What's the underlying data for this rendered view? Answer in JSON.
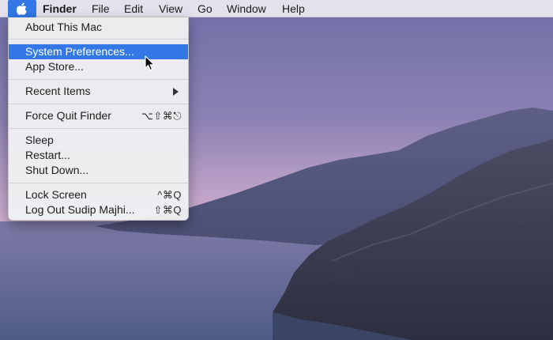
{
  "menubar": {
    "apple_icon": "apple-logo-icon",
    "items": [
      "Finder",
      "File",
      "Edit",
      "View",
      "Go",
      "Window",
      "Help"
    ]
  },
  "apple_menu": {
    "items": [
      {
        "label": "About This Mac",
        "shortcut": ""
      },
      {
        "label": "System Preferences...",
        "shortcut": "",
        "highlighted": true
      },
      {
        "label": "App Store...",
        "shortcut": ""
      },
      {
        "label": "Recent Items",
        "shortcut": "",
        "submenu": true
      },
      {
        "label": "Force Quit Finder",
        "shortcut": "⌥⇧⌘⎋"
      },
      {
        "label": "Sleep",
        "shortcut": ""
      },
      {
        "label": "Restart...",
        "shortcut": ""
      },
      {
        "label": "Shut Down...",
        "shortcut": ""
      },
      {
        "label": "Lock Screen",
        "shortcut": "^⌘Q"
      },
      {
        "label": "Log Out Sudip Majhi...",
        "shortcut": "⇧⌘Q"
      }
    ]
  },
  "colors": {
    "highlight": "#3478e8",
    "menubar_bg": "#eceaf0",
    "menu_bg": "#f0eff2"
  }
}
